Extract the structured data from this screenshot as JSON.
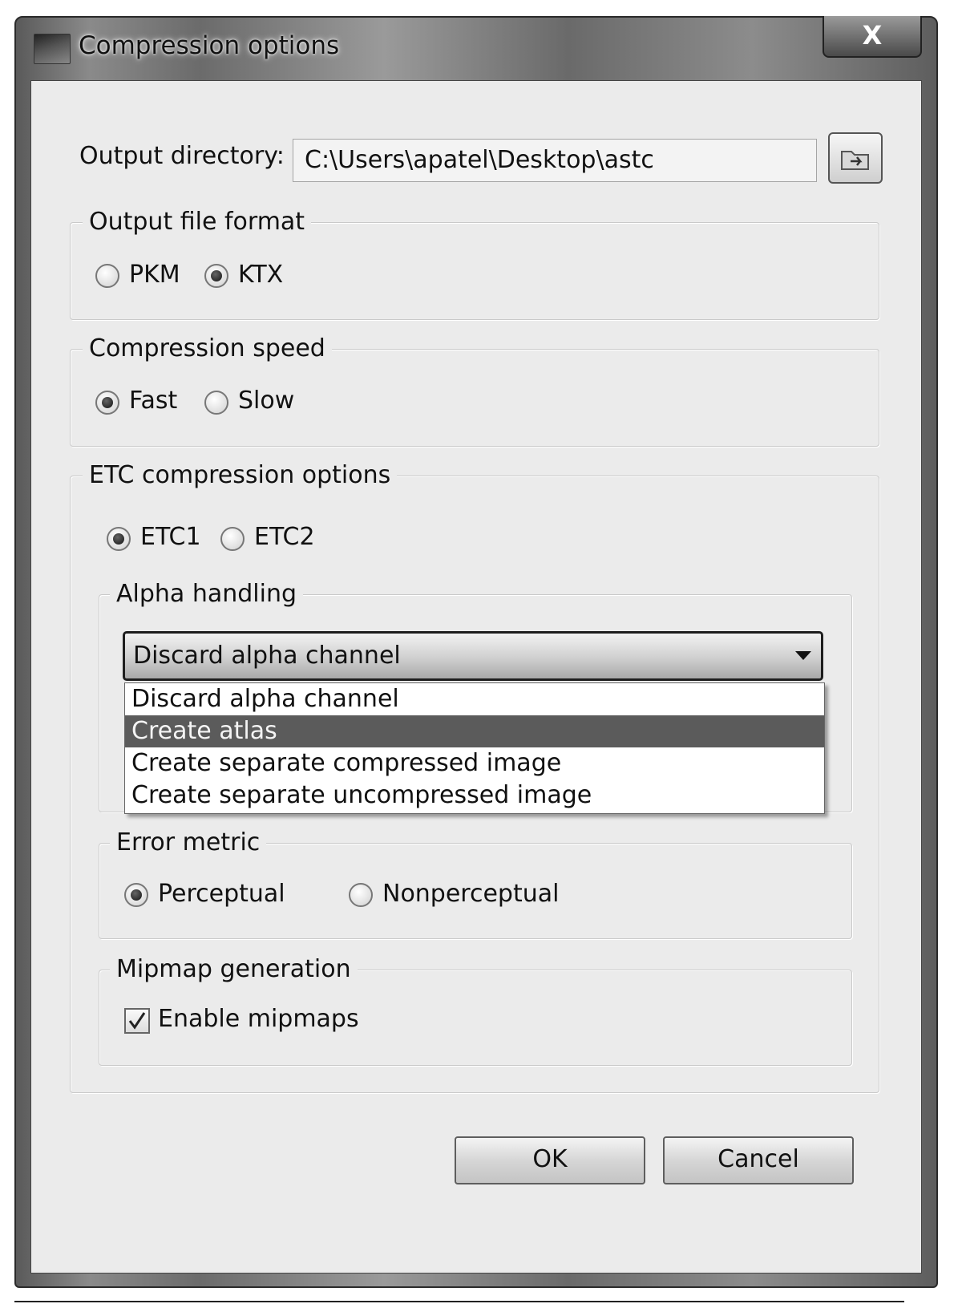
{
  "window": {
    "title": "Compression options",
    "close_glyph": "X"
  },
  "output_directory": {
    "label": "Output directory:",
    "value": "C:\\Users\\apatel\\Desktop\\astc",
    "browse_icon": "folder-browse-icon"
  },
  "output_file_format": {
    "title": "Output file format",
    "options": [
      "PKM",
      "KTX"
    ],
    "selected": "KTX"
  },
  "compression_speed": {
    "title": "Compression speed",
    "options": [
      "Fast",
      "Slow"
    ],
    "selected": "Fast"
  },
  "etc_options": {
    "title": "ETC compression options",
    "versions": [
      "ETC1",
      "ETC2"
    ],
    "selected_version": "ETC1",
    "alpha_handling": {
      "title": "Alpha handling",
      "current": "Discard alpha channel",
      "options": [
        "Discard alpha channel",
        "Create atlas",
        "Create separate compressed image",
        "Create separate uncompressed image"
      ],
      "highlighted": "Create atlas"
    },
    "error_metric": {
      "title": "Error metric",
      "options": [
        "Perceptual",
        "Nonperceptual"
      ],
      "selected": "Perceptual"
    },
    "mipmap": {
      "title": "Mipmap generation",
      "checkbox_label": "Enable mipmaps",
      "checked": true
    }
  },
  "buttons": {
    "ok": "OK",
    "cancel": "Cancel"
  },
  "colors": {
    "dialog_bg": "#ebebeb",
    "highlight": "#5b5b5b",
    "frame": "#6b6b6b"
  }
}
